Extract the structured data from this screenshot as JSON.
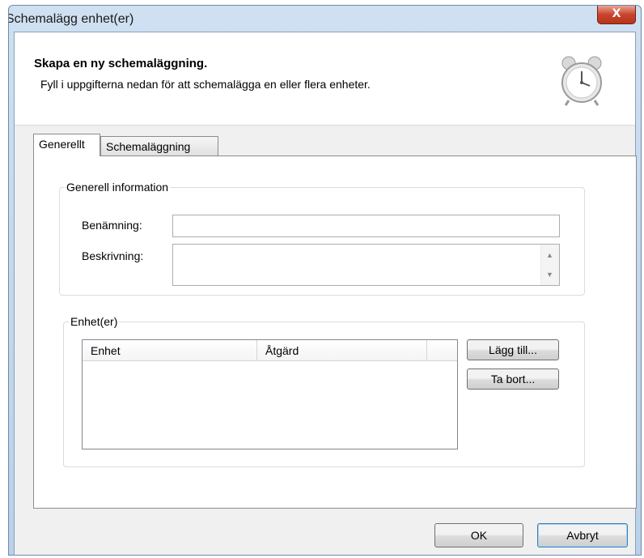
{
  "window": {
    "title": "Schemalägg enhet(er)",
    "close_label": "X"
  },
  "header": {
    "title": "Skapa en ny schemaläggning.",
    "subtitle": "Fyll i uppgifterna nedan för att schemalägga en eller flera enheter.",
    "icon": "alarm-clock-icon"
  },
  "tabs": [
    {
      "label": "Generellt",
      "active": true
    },
    {
      "label": "Schemaläggning",
      "active": false
    }
  ],
  "general_info": {
    "legend": "Generell information",
    "name_label": "Benämning:",
    "name_value": "",
    "description_label": "Beskrivning:",
    "description_value": ""
  },
  "units": {
    "legend": "Enhet(er)",
    "columns": [
      "Enhet",
      "Åtgärd"
    ],
    "rows": [],
    "add_button": "Lägg till...",
    "remove_button": "Ta bort..."
  },
  "footer": {
    "ok_button": "OK",
    "cancel_button": "Avbryt"
  }
}
